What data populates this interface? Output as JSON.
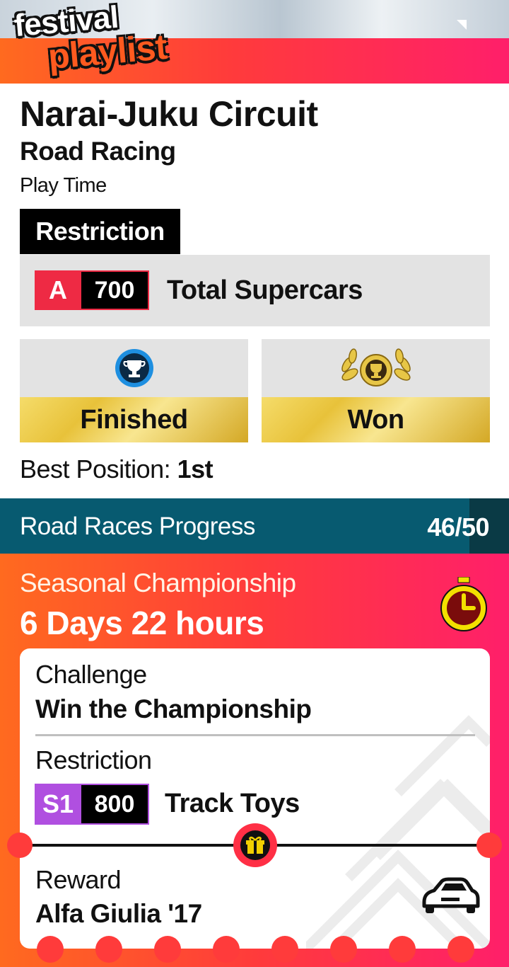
{
  "logo": {
    "line1": "festival",
    "line2": "playlist"
  },
  "event": {
    "title": "Narai-Juku Circuit",
    "type": "Road Racing",
    "play_time_label": "Play Time"
  },
  "restriction": {
    "label": "Restriction",
    "class": "A",
    "pi": "700",
    "class_color": "#ee2a44",
    "name": "Total Supercars"
  },
  "tiles": [
    {
      "label": "Finished",
      "icon": "trophy-badge-icon"
    },
    {
      "label": "Won",
      "icon": "laurel-trophy-icon"
    }
  ],
  "best_position": {
    "label": "Best Position:",
    "value": "1st"
  },
  "progress": {
    "label": "Road Races Progress",
    "count": "46/50",
    "fraction": 0.92
  },
  "seasonal": {
    "title": "Seasonal Championship",
    "time_left": "6 Days 22 hours",
    "icon": "stopwatch-icon"
  },
  "ticket": {
    "challenge_label": "Challenge",
    "challenge_value": "Win the Championship",
    "restriction_label": "Restriction",
    "class": "S1",
    "pi": "800",
    "class_color": "#b04fe0",
    "restriction_name": "Track Toys",
    "reward_label": "Reward",
    "reward_value": "Alfa Giulia '17",
    "reward_icon": "car-icon",
    "gift_icon": "gift-icon"
  },
  "colors": {
    "accent_orange": "#ff6a1f",
    "accent_pink": "#ff1f6a",
    "progress_bar": "#075a70",
    "gold": "#e8c23a"
  }
}
